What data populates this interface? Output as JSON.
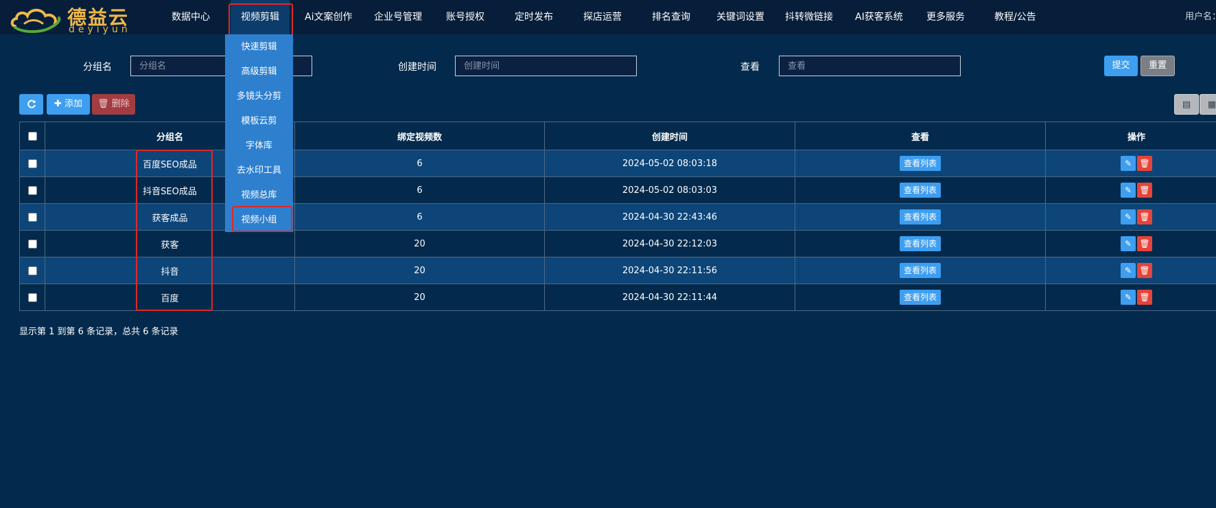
{
  "brand": {
    "name_cn": "德益云",
    "name_en": "deyiyun",
    "colors": {
      "logo": "#f0b84a",
      "accent": "#3e9ef0",
      "danger": "#e6443a"
    }
  },
  "nav": {
    "items": [
      {
        "label": "数据中心"
      },
      {
        "label": "视频剪辑"
      },
      {
        "label": "Ai文案创作"
      },
      {
        "label": "企业号管理"
      },
      {
        "label": "账号授权"
      },
      {
        "label": "定时发布"
      },
      {
        "label": "探店运营"
      },
      {
        "label": "排名查询"
      },
      {
        "label": "关键词设置"
      },
      {
        "label": "抖转微链接"
      },
      {
        "label": "AI获客系统"
      },
      {
        "label": "更多服务"
      },
      {
        "label": "教程/公告"
      }
    ],
    "active": "视频剪辑",
    "user_label": "用户名："
  },
  "dropdown": {
    "items": [
      "快速剪辑",
      "高级剪辑",
      "多镜头分剪",
      "模板云剪",
      "字体库",
      "去水印工具",
      "视频总库",
      "视频小组"
    ],
    "highlighted": "视频小组"
  },
  "search": {
    "group_label": "分组名",
    "group_placeholder": "分组名",
    "created_label": "创建时间",
    "created_placeholder": "创建时间",
    "view_label": "查看",
    "view_placeholder": "查看",
    "submit": "提交",
    "reset": "重置"
  },
  "toolbar": {
    "refresh_icon": "refresh-icon",
    "add": "✚ 添加",
    "delete": "🗑 删除"
  },
  "table": {
    "columns": [
      "分组名",
      "绑定视频数",
      "创建时间",
      "查看",
      "操作"
    ],
    "rows": [
      {
        "name": "百度SEO成品",
        "count": "6",
        "created": "2024-05-02 08:03:18",
        "view": "查看列表"
      },
      {
        "name": "抖音SEO成品",
        "count": "6",
        "created": "2024-05-02 08:03:03",
        "view": "查看列表"
      },
      {
        "name": "获客成品",
        "count": "6",
        "created": "2024-04-30 22:43:46",
        "view": "查看列表"
      },
      {
        "name": "获客",
        "count": "20",
        "created": "2024-04-30 22:12:03",
        "view": "查看列表"
      },
      {
        "name": "抖音",
        "count": "20",
        "created": "2024-04-30 22:11:56",
        "view": "查看列表"
      },
      {
        "name": "百度",
        "count": "20",
        "created": "2024-04-30 22:11:44",
        "view": "查看列表"
      }
    ]
  },
  "footer": {
    "summary": "显示第 1 到第 6 条记录，总共 6 条记录"
  }
}
